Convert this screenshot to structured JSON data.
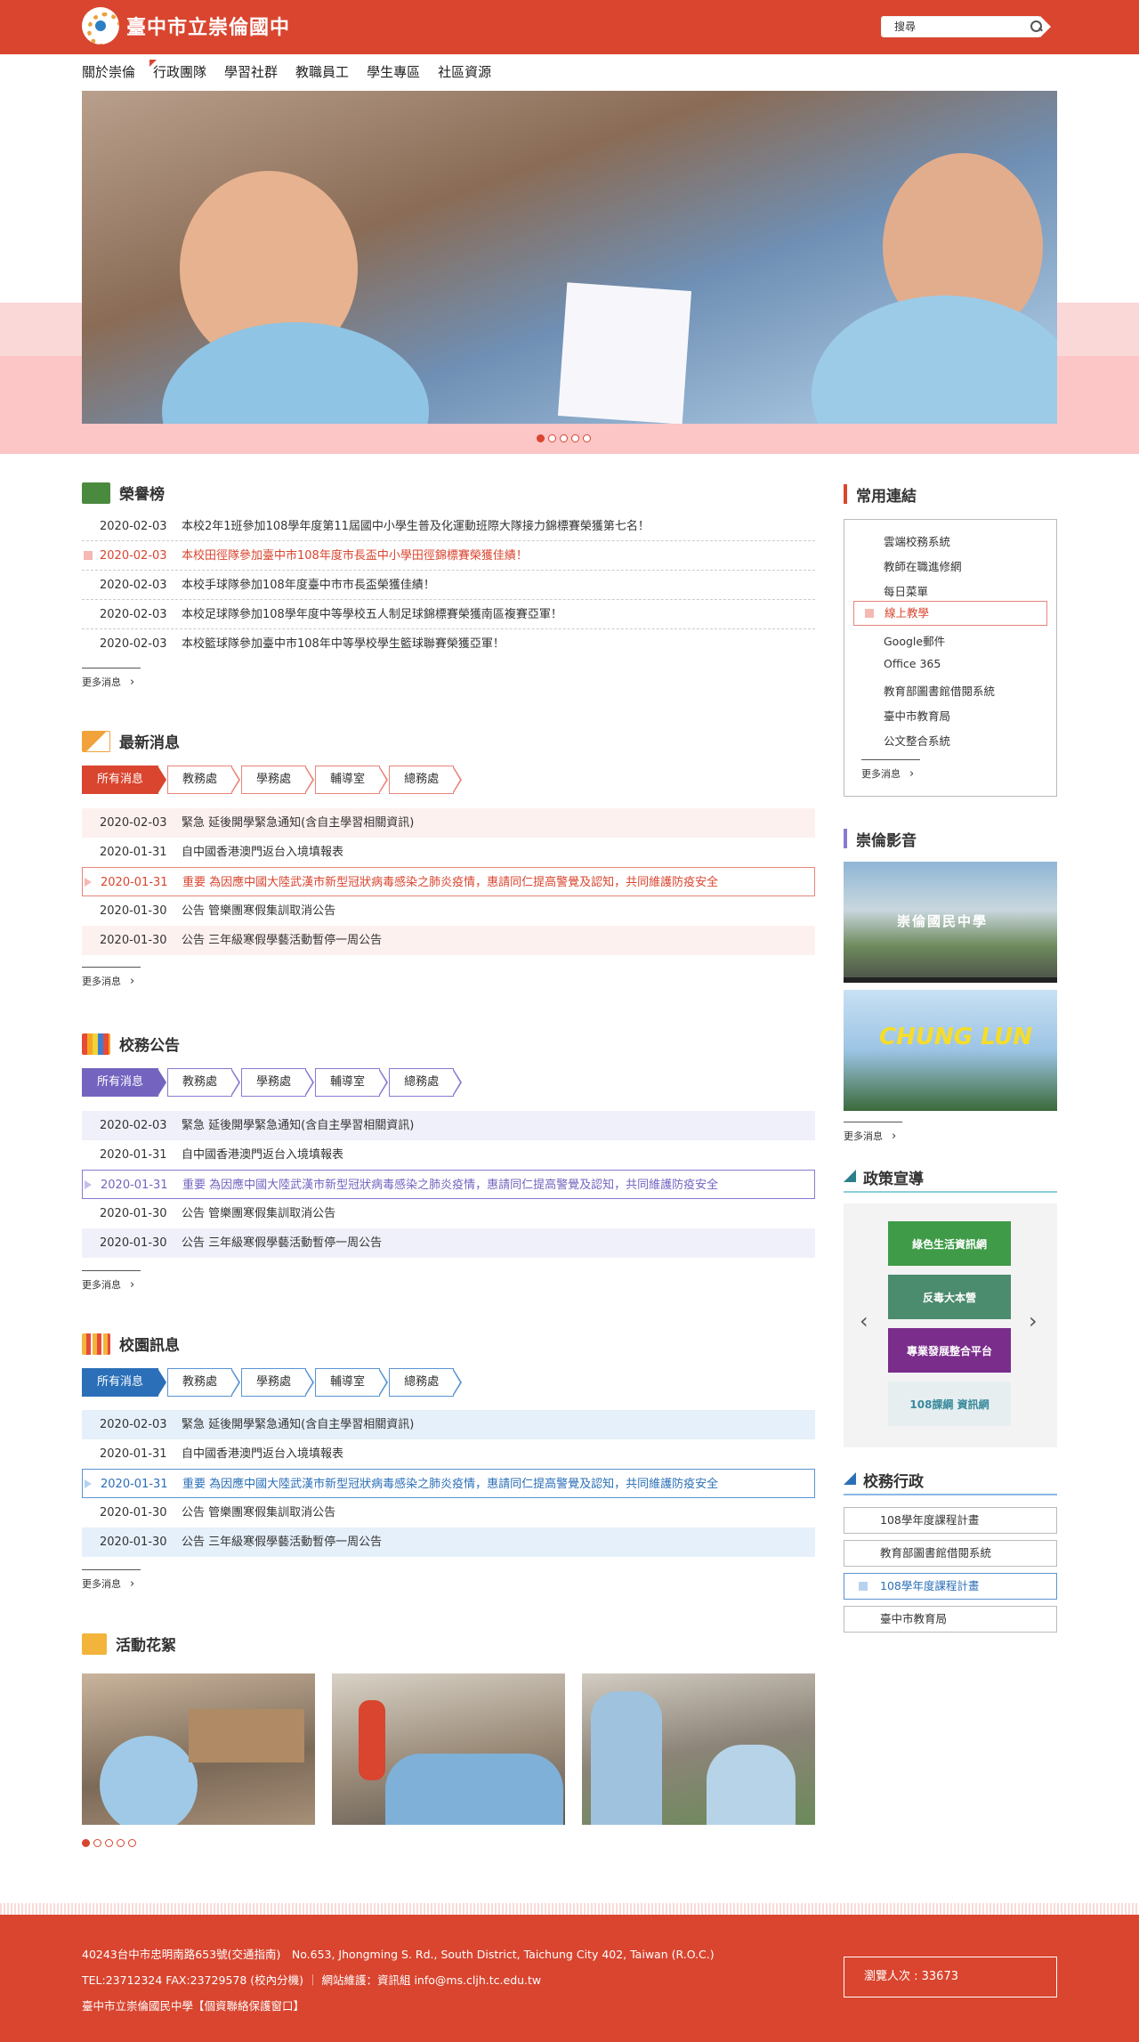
{
  "header": {
    "site_name": "臺中市立崇倫國中",
    "search_placeholder": "搜尋"
  },
  "nav": [
    "關於崇倫",
    "行政團隊",
    "學習社群",
    "教職員工",
    "學生專區",
    "社區資源"
  ],
  "honors": {
    "title": "榮譽榜",
    "items": [
      {
        "date": "2020-02-03",
        "text": "本校2年1班參加108學年度第11屆國中小學生普及化運動班際大隊接力錦標賽榮獲第七名！"
      },
      {
        "date": "2020-02-03",
        "text": "本校田徑隊參加臺中市108年度市長盃中小學田徑錦標賽榮獲佳績！"
      },
      {
        "date": "2020-02-03",
        "text": "本校手球隊參加108年度臺中市市長盃榮獲佳績！"
      },
      {
        "date": "2020-02-03",
        "text": "本校足球隊參加108學年度中等學校五人制足球錦標賽榮獲南區複賽亞軍！"
      },
      {
        "date": "2020-02-03",
        "text": "本校籃球隊參加臺中市108年中等學校學生籃球聯賽榮獲亞軍！"
      }
    ],
    "more": "更多消息"
  },
  "tabs": [
    "所有消息",
    "教務處",
    "學務處",
    "輔導室",
    "總務處"
  ],
  "news_items": [
    {
      "date": "2020-02-03",
      "text": "緊急 延後開學緊急通知(含自主學習相關資訊)"
    },
    {
      "date": "2020-01-31",
      "text": "自中國香港澳門返台入境填報表"
    },
    {
      "date": "2020-01-31",
      "text": "重要 為因應中國大陸武漢市新型冠狀病毒感染之肺炎疫情，惠請同仁提高警覺及認知，共同維護防疫安全"
    },
    {
      "date": "2020-01-30",
      "text": "公告 管樂團寒假集訓取消公告"
    },
    {
      "date": "2020-01-30",
      "text": "公告 三年級寒假學藝活動暫停一周公告"
    }
  ],
  "latest": {
    "title": "最新消息",
    "more": "更多消息"
  },
  "affairs": {
    "title": "校務公告",
    "more": "更多消息"
  },
  "campus": {
    "title": "校園訊息",
    "more": "更多消息"
  },
  "gallery": {
    "title": "活動花絮"
  },
  "sidebar": {
    "links_title": "常用連結",
    "links": [
      "雲端校務系統",
      "教師在職進修網",
      "每日菜單",
      "線上教學",
      "Google郵件",
      "Office 365",
      "教育部圖書館借閱系統",
      "臺中市教育局",
      "公文整合系統"
    ],
    "links_more": "更多消息",
    "video_title": "崇倫影音",
    "video_text": [
      "崇倫國民中學",
      "CHUNG LUN"
    ],
    "video_more": "更多消息",
    "policy_title": "政策宣導",
    "policy": [
      "綠色生活資訊網",
      "反毒大本營",
      "專業發展整合平台",
      "108課綱 資訊網"
    ],
    "admin_title": "校務行政",
    "admin": [
      "108學年度課程計畫",
      "教育部圖書館借閱系統",
      "108學年度課程計畫",
      "臺中市教育局"
    ]
  },
  "footer": {
    "line1": "40243台中市忠明南路653號(交通指南)　No.653, Jhongming S. Rd., South District, Taichung City 402, Taiwan (R.O.C.)",
    "line2": "TEL:23712324 FAX:23729578 (校內分機) ｜ 網站維護：資訊組 info@ms.cljh.tc.edu.tw",
    "line3": "臺中市立崇倫國民中學【個資聯絡保護窗口】",
    "visits": "瀏覽人次 : 33673"
  },
  "colors": {
    "primary": "#d9452f",
    "purple": "#7464c0",
    "blue": "#2b6fb8"
  }
}
